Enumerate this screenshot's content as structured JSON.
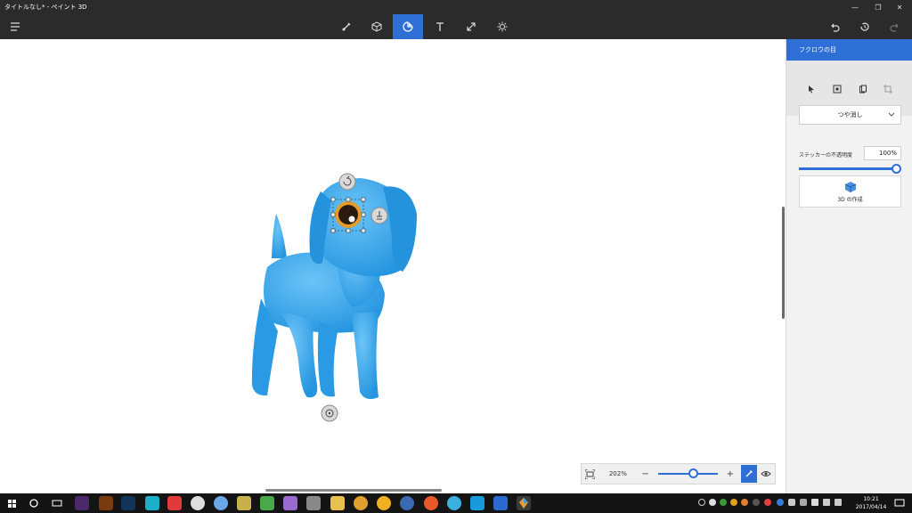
{
  "window": {
    "title": "タイトルなし* - ペイント 3D",
    "controls": {
      "minimize": "minimize-icon",
      "maximize": "restore-icon",
      "close": "close-icon"
    }
  },
  "toolbar": {
    "menu_icon": "hamburger-icon",
    "tools": [
      "brush-icon",
      "cube-icon",
      "sticker-icon",
      "text-icon",
      "resize-icon",
      "effects-icon"
    ],
    "active_tool": "sticker-icon",
    "history": [
      "undo-icon",
      "history-icon",
      "redo-icon"
    ]
  },
  "panel": {
    "title": "フクロウの目",
    "tools": [
      "select-icon",
      "stamp-icon",
      "copy-icon",
      "crop-icon"
    ],
    "finish_dropdown": {
      "value": "つや消し"
    },
    "opacity": {
      "label": "ステッカーの不透明度",
      "value": "100%",
      "level": 1.0
    },
    "make3d_label": "3D の作成"
  },
  "zoombar": {
    "fit_icon": "fit-to-screen-icon",
    "percent": "202%",
    "minus": "−",
    "plus": "+",
    "level": 0.5
  },
  "taskbar": {
    "clock_time": "10:21",
    "clock_date": "2017/04/14"
  },
  "colors": {
    "accent": "#2e6fd6",
    "chrome": "#2b2b2b",
    "dog": "#3aa9ee",
    "eye_ring": "#e39b2a"
  }
}
